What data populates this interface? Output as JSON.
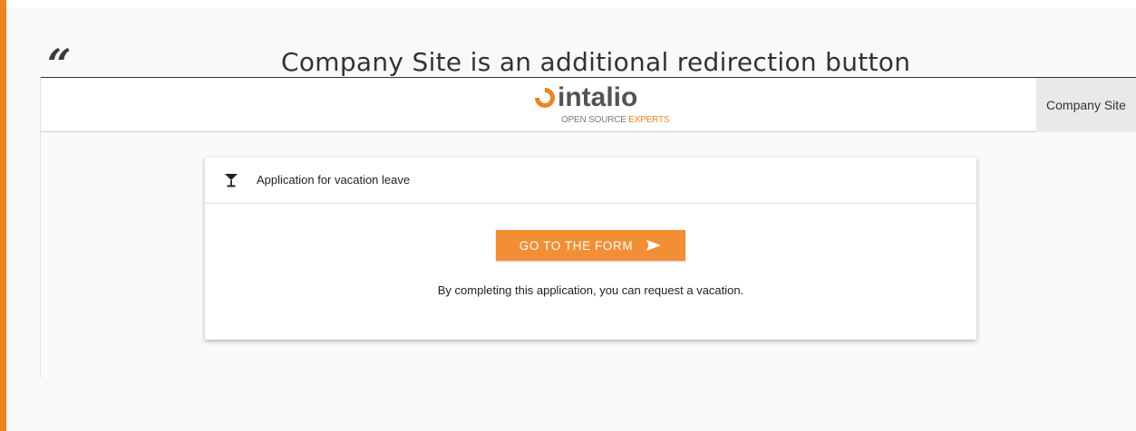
{
  "quote_mark": "“",
  "caption": "Company Site is an additional redirection button",
  "header": {
    "logo": {
      "wordmark": "intalio",
      "tagline_grey": "OPEN SOURCE",
      "tagline_orange": "EXPERTS"
    },
    "company_site_label": "Company Site"
  },
  "card": {
    "icon": "cocktail-glass-icon",
    "title": "Application for vacation leave",
    "button_label": "GO TO THE FORM",
    "button_icon": "send-icon",
    "description": "By completing this application, you can request a vacation."
  },
  "colors": {
    "accent": "#f0831f",
    "button": "#f38e34"
  }
}
